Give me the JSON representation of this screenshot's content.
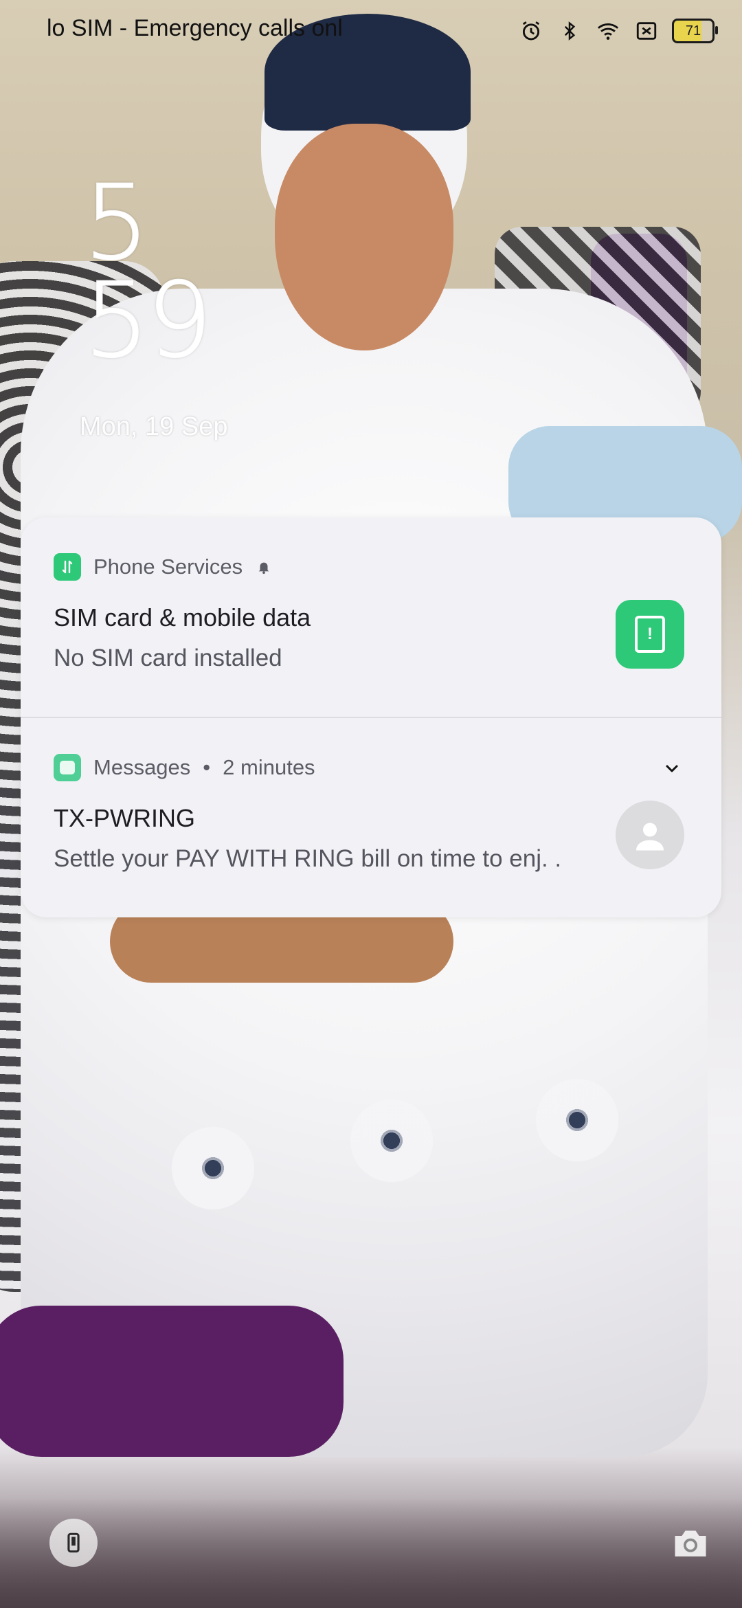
{
  "status_bar": {
    "carrier_text": "lo SIM - Emergency calls onl",
    "battery_level": "71",
    "icons": [
      "alarm-icon",
      "bluetooth-icon",
      "wifi-icon",
      "no-sim-icon",
      "battery-icon"
    ]
  },
  "lockscreen": {
    "clock_hour": "5",
    "clock_minute": "59",
    "date": "Mon, 19 Sep"
  },
  "notifications": [
    {
      "app": "Phone Services",
      "title": "SIM card & mobile data",
      "body": "No SIM card installed",
      "icon": "data-transfer-icon",
      "action_icon": "sim-alert-icon",
      "accent": "#2dc878"
    },
    {
      "app": "Messages",
      "meta_separator": "•",
      "time": "2 minutes",
      "title": "TX-PWRING",
      "body": "Settle your PAY WITH RING bill on time to enj. .",
      "icon": "messages-icon",
      "avatar": "contact-avatar-icon"
    }
  ],
  "shortcuts": {
    "left": "phone-shortcut-icon",
    "right": "camera-shortcut-icon"
  }
}
